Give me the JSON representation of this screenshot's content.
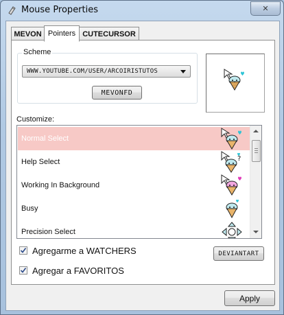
{
  "window": {
    "title": "Mouse Properties",
    "close_glyph": "✕"
  },
  "tabs": [
    {
      "label": "MEVON",
      "active": false
    },
    {
      "label": "Pointers",
      "active": true
    },
    {
      "label": "CUTECURSOR",
      "active": false
    }
  ],
  "scheme": {
    "group_label": "Scheme",
    "selected": "WWW.YOUTUBE.COM/USER/ARCOIRISTUTOS",
    "button_label": "MEVONFD"
  },
  "customize": {
    "label": "Customize:",
    "items": [
      {
        "label": "Normal Select",
        "selected": true,
        "icon": "ice-cream-cursor-icon"
      },
      {
        "label": "Help Select",
        "selected": false,
        "icon": "ice-cream-help-cursor-icon"
      },
      {
        "label": "Working In Background",
        "selected": false,
        "icon": "ice-cream-working-cursor-icon"
      },
      {
        "label": "Busy",
        "selected": false,
        "icon": "ice-cream-busy-cursor-icon"
      },
      {
        "label": "Precision Select",
        "selected": false,
        "icon": "ice-cream-precision-cursor-icon"
      }
    ]
  },
  "options": {
    "watchers_label": "Agregarme a WATCHERS",
    "watchers_checked": true,
    "favoritos_label": "Agregar a FAVORITOS",
    "favoritos_checked": true,
    "deviantart_label": "DEVIANTART"
  },
  "footer": {
    "apply_label": "Apply"
  },
  "colors": {
    "selected_row": "#f7c9c6",
    "ice_cream_mint": "#bfe9ee",
    "cone": "#e9b46a",
    "heart": "#2ec4d6"
  }
}
